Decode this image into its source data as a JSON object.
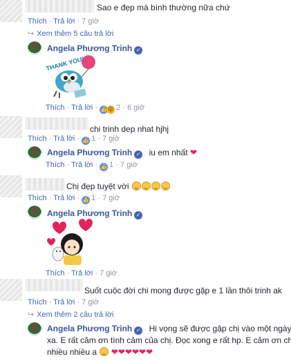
{
  "comments": [
    {
      "text": "Sao e đẹp mà bình thường nữa chứ",
      "actions": {
        "like": "Thích",
        "reply": "Trả lời",
        "time": "7 giờ"
      },
      "more_replies": "Xem thêm 5 câu trả lời"
    },
    {
      "text": "chi trinh dep nhat hjhj",
      "actions": {
        "like": "Thích",
        "reply": "Trả lời",
        "like_count": "1",
        "time": "7 giờ"
      }
    },
    {
      "text": "Chị đẹp tuyệt vời",
      "actions": {
        "like": "Thích",
        "reply": "Trả lời",
        "like_count": "1",
        "time": "7 giờ"
      }
    },
    {
      "text": "Suốt cuộc đời chi mong được gặp e 1 lần thôi trinh ak",
      "actions": {
        "like": "Thích",
        "reply": "Trả lời",
        "time": "7 giờ"
      },
      "more_replies": "Xem thêm 2 câu trả lời"
    }
  ],
  "replies": [
    {
      "author": "Angela Phương Trinh",
      "sticker_text": "THANK YOU!",
      "actions": {
        "like": "Thích",
        "reply": "Trả lời",
        "like_count": "2",
        "time": "6 giờ"
      }
    },
    {
      "author": "Angela Phương Trinh",
      "text": "iu em nhất",
      "actions": {
        "like": "Thích",
        "reply": "Trả lời",
        "like_count": "1",
        "time": "7 giờ"
      }
    },
    {
      "author": "Angela Phương Trinh",
      "actions": {
        "like": "Thích",
        "reply": "Trả lời",
        "time": "7 giờ"
      }
    },
    {
      "author": "Angela Phương Trinh",
      "text_line1": "Hi vọng sẽ được gặp chị vào một ngày ko",
      "text_line2": "xa. E rất cảm ơn tình cảm của chị. Đọc xong e rất hp. E cảm ơn chị",
      "text_line3": "nhiều nhiều a"
    }
  ],
  "separator": "·",
  "colors": {
    "link": "#4267b2",
    "name": "#365899",
    "meta": "#90949c",
    "heart": "#e0245e"
  }
}
